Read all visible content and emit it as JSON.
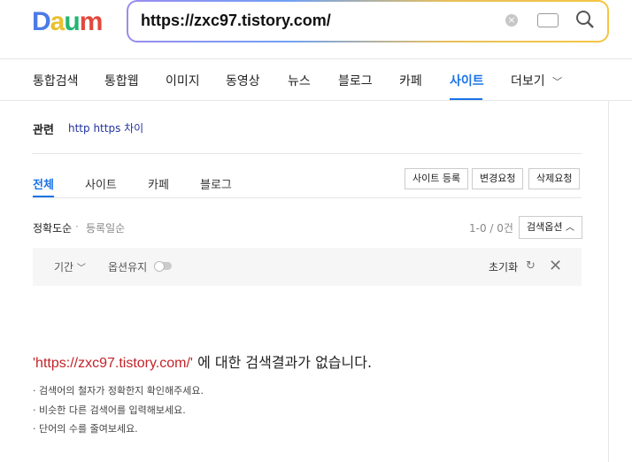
{
  "logo": {
    "text": "Daum"
  },
  "search": {
    "query": "https://zxc97.tistory.com/"
  },
  "nav": {
    "items": [
      "통합검색",
      "통합웹",
      "이미지",
      "동영상",
      "뉴스",
      "블로그",
      "카페",
      "사이트",
      "더보기"
    ],
    "active": "사이트"
  },
  "related": {
    "label": "관련",
    "link": "http https 차이"
  },
  "subtabs": {
    "items": [
      "전체",
      "사이트",
      "카페",
      "블로그"
    ],
    "active": "전체"
  },
  "actions": {
    "register": "사이트 등록",
    "change": "변경요청",
    "delete": "삭제요청"
  },
  "sort": {
    "accuracy": "정확도순",
    "registered": "등록일순",
    "count": "1-0 / 0건",
    "options": "검색옵션"
  },
  "filters": {
    "period": "기간",
    "keep": "옵션유지",
    "reset": "초기화"
  },
  "noresult": {
    "query": "'https://zxc97.tistory.com/'",
    "suffix": " 에 대한 검색결과가 없습니다."
  },
  "tips": [
    "· 검색어의 철자가 정확한지 확인해주세요.",
    "· 비슷한 다른 검색어를 입력해보세요.",
    "· 단어의 수를 줄여보세요."
  ],
  "colors": {
    "accent": "#1a73e8",
    "query_red": "#c2242a"
  }
}
